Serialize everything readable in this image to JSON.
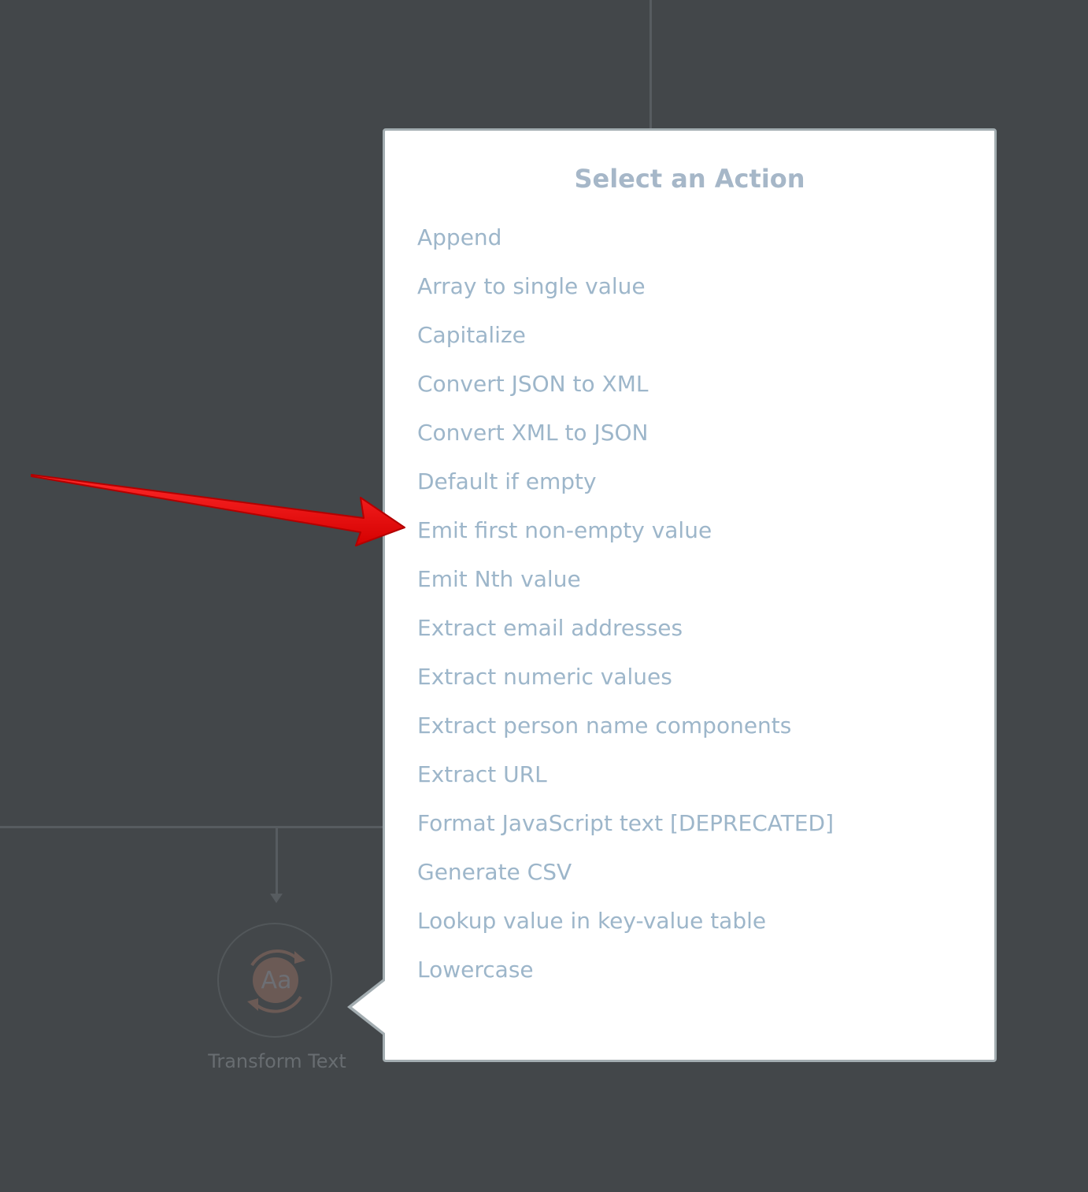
{
  "colors": {
    "canvas_background": "#43474a",
    "popup_background": "#ffffff",
    "popup_border": "#a3adb1",
    "title_color": "#a6b7c8",
    "action_text_color": "#9db6ca",
    "annotation_arrow": "#ee0000",
    "node_icon_accent": "#6b5a55"
  },
  "node": {
    "icon": "transform-text-icon",
    "icon_text": "Aa",
    "label": "Transform Text"
  },
  "popup": {
    "title": "Select an Action",
    "actions": [
      "Append",
      "Array to single value",
      "Capitalize",
      "Convert JSON to XML",
      "Convert XML to JSON",
      "Default if empty",
      "Emit first non-empty value",
      "Emit Nth value",
      "Extract email addresses",
      "Extract numeric values",
      "Extract person name components",
      "Extract URL",
      "Format JavaScript text [DEPRECATED]",
      "Generate CSV",
      "Lookup value in key-value table",
      "Lowercase"
    ]
  },
  "annotation": {
    "icon": "red-arrow-icon",
    "points_to": "Emit first non-empty value"
  }
}
